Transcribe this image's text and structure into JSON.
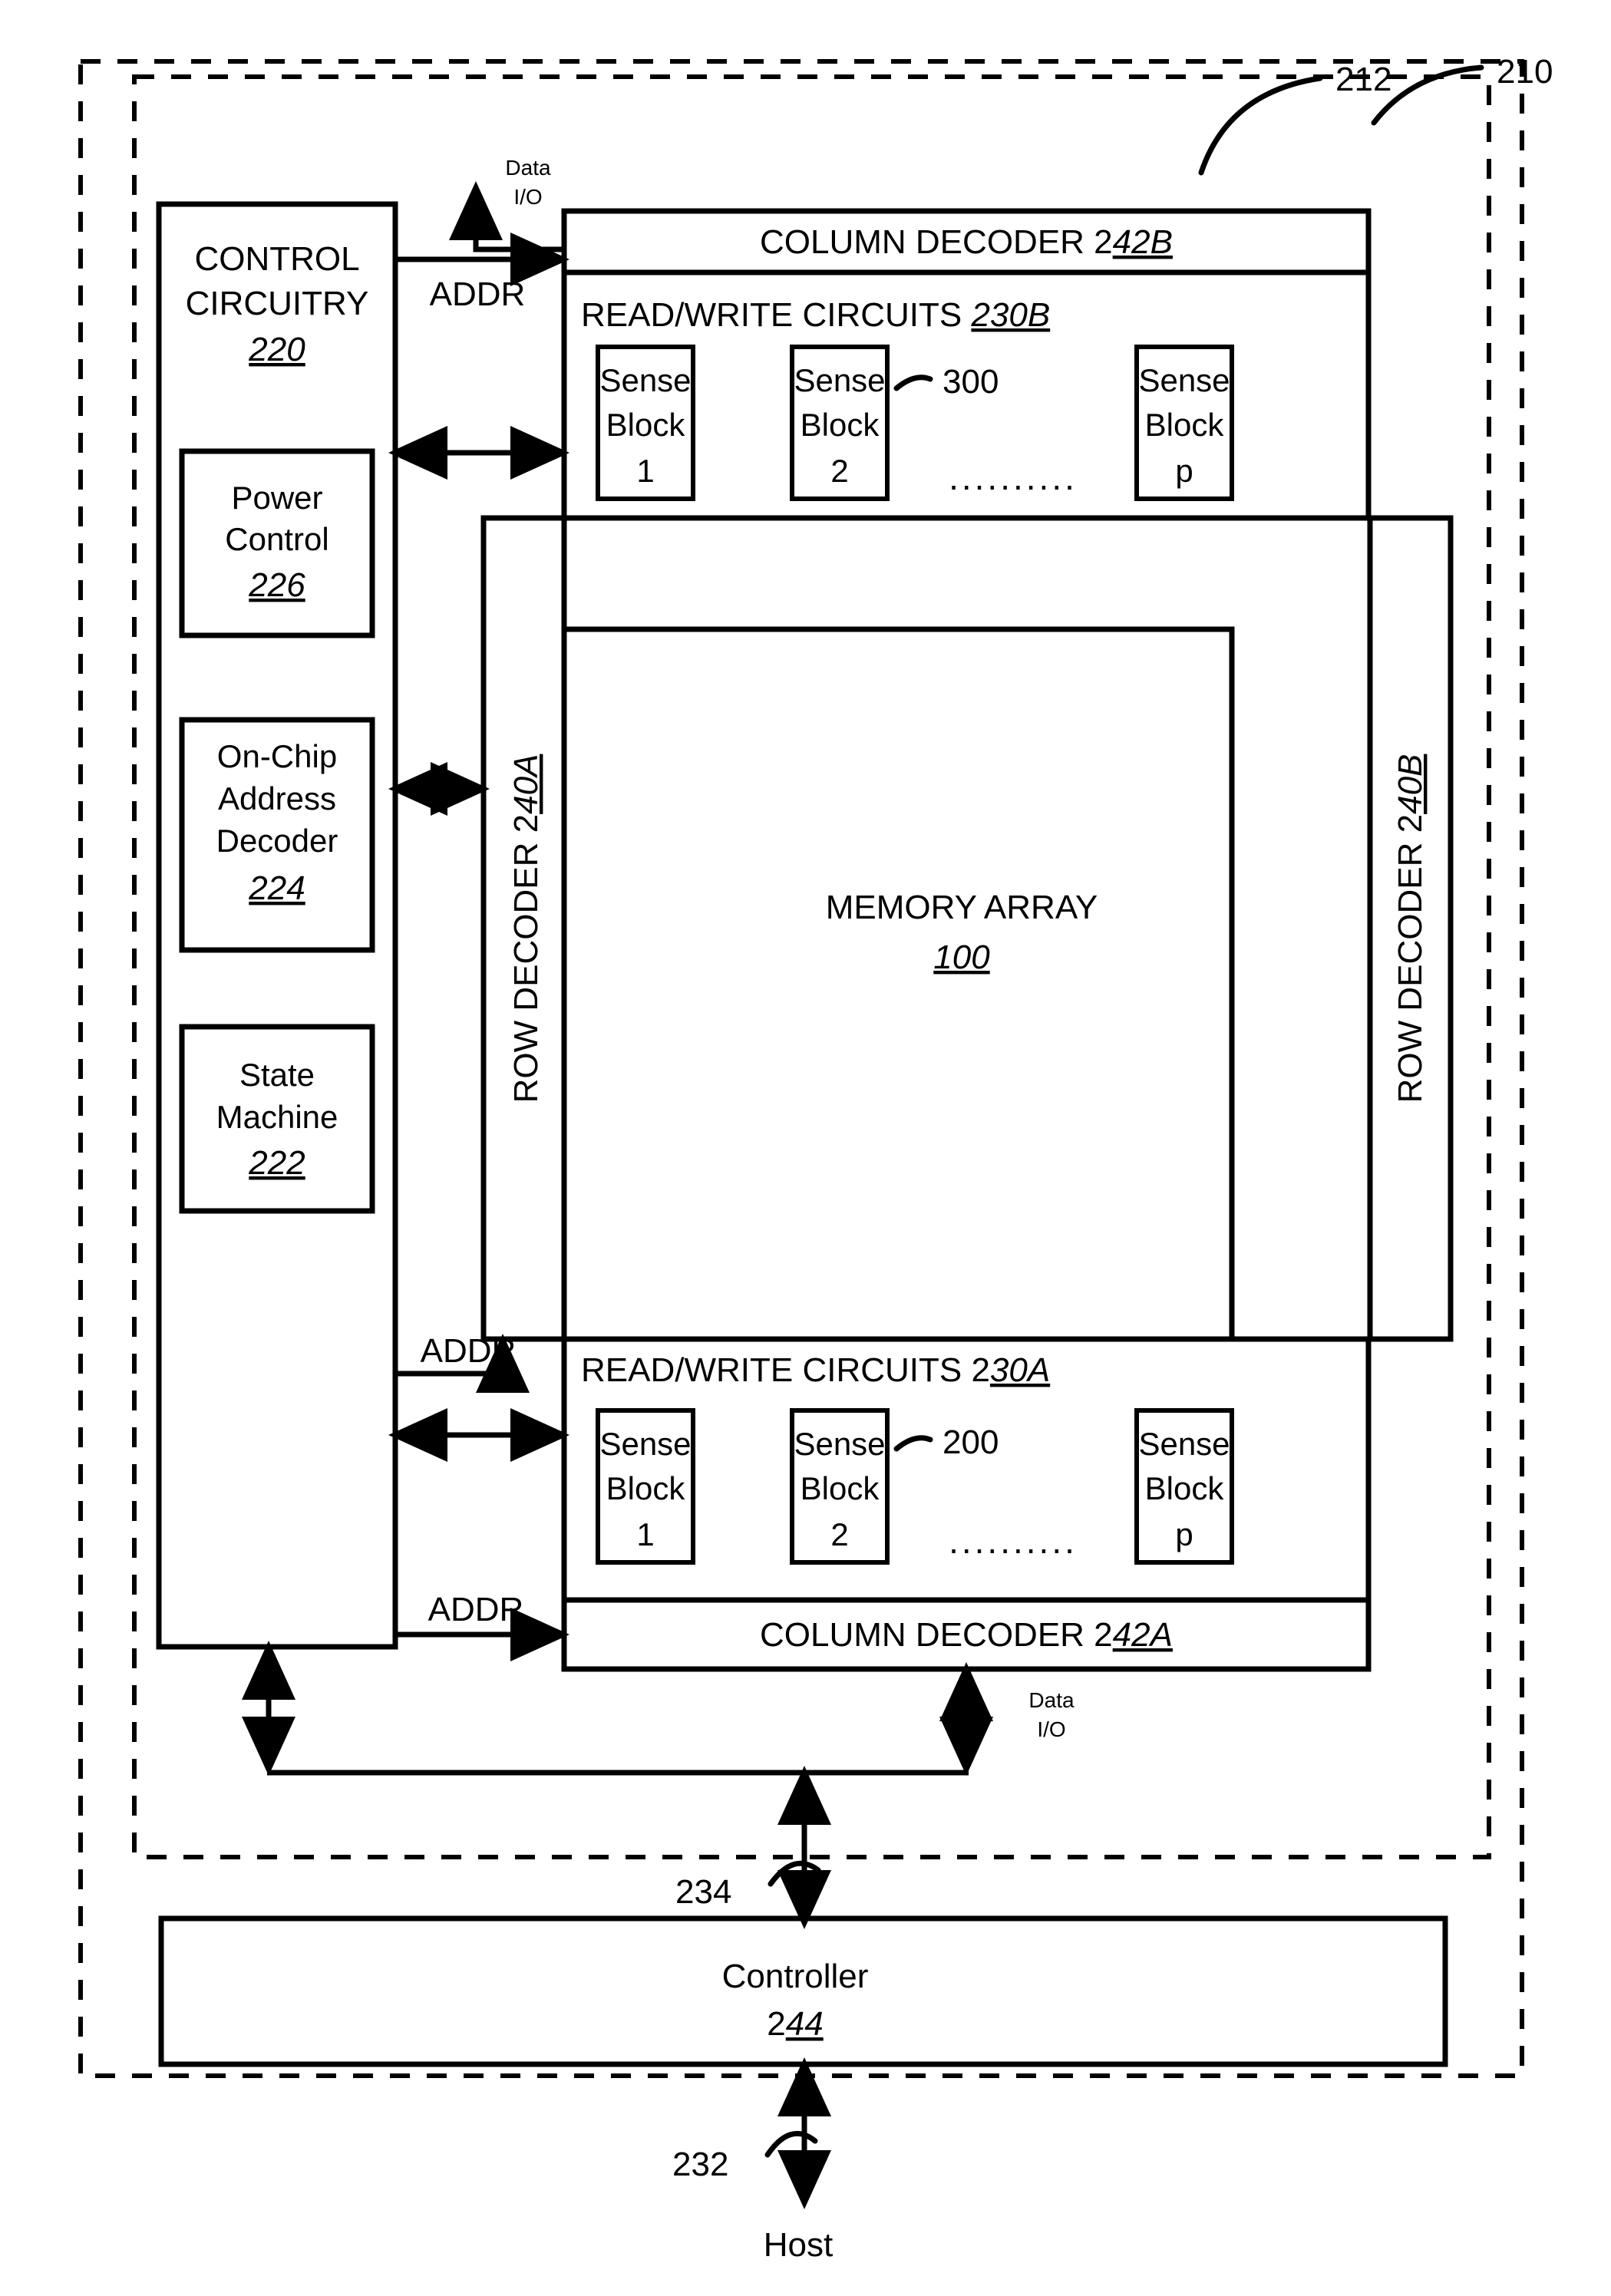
{
  "figure": {
    "outer_enclosure_ref": "210",
    "inner_enclosure_ref": "212"
  },
  "control_circuitry": {
    "title_line1": "CONTROL",
    "title_line2": "CIRCUITRY",
    "ref": "220",
    "blocks": [
      {
        "line1": "Power",
        "line2": "Control",
        "ref": "226"
      },
      {
        "line1": "On-Chip",
        "line2": "Address",
        "line3": "Decoder",
        "ref": "224"
      },
      {
        "line1": "State",
        "line2": "Machine",
        "ref": "222"
      }
    ]
  },
  "signals": {
    "addr_top": "ADDR",
    "addr_mid": "ADDR",
    "addr_bottom": "ADDR",
    "data_io_top_line1": "Data",
    "data_io_top_line2": "I/O",
    "data_io_bottom_line1": "Data",
    "data_io_bottom_line2": "I/O"
  },
  "column_decoder_top": {
    "label_plain": "COLUMN DECODER 2",
    "label_ref": "42B"
  },
  "column_decoder_bottom": {
    "label_plain": "COLUMN DECODER 2",
    "label_ref": "42A"
  },
  "read_write_top": {
    "label_plain": "READ/WRITE CIRCUITS ",
    "label_ref": "230B",
    "group_ref": "300",
    "ellipsis": "..........",
    "sense_blocks": [
      {
        "line1": "Sense",
        "line2": "Block",
        "index": "1"
      },
      {
        "line1": "Sense",
        "line2": "Block",
        "index": "2"
      },
      {
        "line1": "Sense",
        "line2": "Block",
        "index": "p"
      }
    ]
  },
  "read_write_bottom": {
    "label_plain": "READ/WRITE CIRCUITS 2",
    "label_ref": "30A",
    "group_ref": "200",
    "ellipsis": "..........",
    "sense_blocks": [
      {
        "line1": "Sense",
        "line2": "Block",
        "index": "1"
      },
      {
        "line1": "Sense",
        "line2": "Block",
        "index": "2"
      },
      {
        "line1": "Sense",
        "line2": "Block",
        "index": "p"
      }
    ]
  },
  "row_decoder_left": {
    "label_plain": "ROW DECODER 2",
    "label_ref": "40A"
  },
  "row_decoder_right": {
    "label_plain": "ROW DECODER 2",
    "label_ref": "40B"
  },
  "memory_array": {
    "label": "MEMORY ARRAY",
    "ref": "100"
  },
  "controller": {
    "label_plain": "Controller",
    "ref_plain": "2",
    "ref_italic": "44",
    "bus_ref": "234"
  },
  "host": {
    "label": "Host",
    "bus_ref": "232"
  }
}
